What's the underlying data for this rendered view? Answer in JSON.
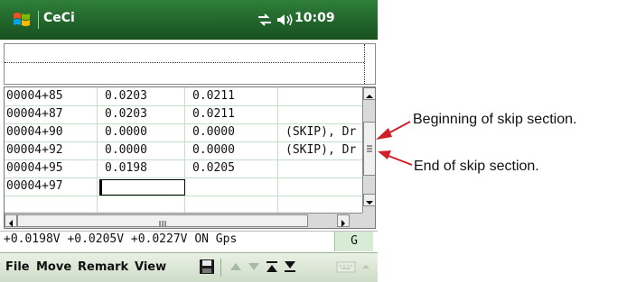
{
  "window": {
    "title": "CeCi",
    "clock": "10:09"
  },
  "grid": {
    "rows": [
      [
        "00004+85",
        "0.0203",
        "0.0211",
        ""
      ],
      [
        "00004+87",
        "0.0203",
        "0.0211",
        ""
      ],
      [
        "00004+90",
        "0.0000",
        "0.0000",
        "(SKIP), Dr"
      ],
      [
        "00004+92",
        "0.0000",
        "0.0000",
        "(SKIP), Dr"
      ],
      [
        "00004+95",
        "0.0198",
        "0.0205",
        ""
      ],
      [
        "00004+97",
        "",
        "",
        ""
      ],
      [
        "",
        "",
        "",
        ""
      ]
    ]
  },
  "status": {
    "readout": "+0.0198V +0.0205V +0.0227V ON  Gps",
    "gps": "G"
  },
  "menu": {
    "file": "File",
    "move": "Move",
    "remark": "Remark",
    "view": "View"
  },
  "annotations": {
    "begin": "Beginning of skip section.",
    "end": "End of skip section."
  },
  "colors": {
    "title_bar": "#1f6a2a",
    "annotation_arrow": "#d0202a",
    "gps_indicator": "#d7ecd4"
  },
  "icons": {
    "start": "windows-flag-icon",
    "connectivity": "connectivity-icon",
    "volume": "volume-icon",
    "save": "floppy-disk-icon",
    "up": "up-triangle-icon",
    "down": "down-triangle-icon",
    "first": "jump-top-icon",
    "last": "jump-bottom-icon",
    "keyboard": "keyboard-icon"
  }
}
